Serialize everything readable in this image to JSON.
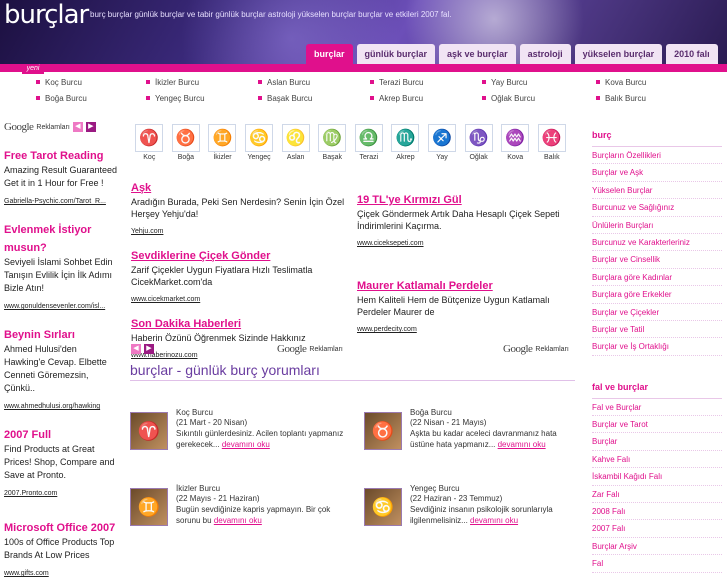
{
  "header": {
    "logo": "burçlar",
    "tagline": "burç burçlar günlük burçlar ve tabir günlük burçlar astroloji yükselen burçlar burçlar ve etkileri 2007 fal."
  },
  "tabs": [
    "burçlar",
    "günlük burçlar",
    "aşk ve burçlar",
    "astroloji",
    "yükselen burçlar",
    "2010 falı"
  ],
  "yeni": "yeni",
  "sign_nav": [
    "Koç Burcu",
    "İkizler Burcu",
    "Aslan Burcu",
    "Terazi Burcu",
    "Yay Burcu",
    "Kova Burcu",
    "Boğa Burcu",
    "Yengeç Burcu",
    "Başak Burcu",
    "Akrep Burcu",
    "Oğlak Burcu",
    "Balık Burcu"
  ],
  "google": {
    "logo": "Google",
    "label": "Reklamları"
  },
  "left_ads": [
    {
      "title": "Free Tarot Reading",
      "body": "Amazing Result Guaranteed Get it in 1 Hour for Free !",
      "url": "Gabriella-Psychic.com/Tarot_R..."
    },
    {
      "title": "Evlenmek İstiyor musun?",
      "body": "Seviyeli İslami Sohbet Edin Tanışın Evlilik İçin İlk Adımı Bizle Atın!",
      "url": "www.gonuldensevenler.com/isl..."
    },
    {
      "title": "Beynin Sırları",
      "body": "Ahmed Hulusi'den Hawking'e Cevap. Elbette Cenneti Göremezsin, Çünkü..",
      "url": "www.ahmedhulusi.org/hawking"
    },
    {
      "title": "2007 Full",
      "body": "Find Products at Great Prices! Shop, Compare and Save at Pronto.",
      "url": "2007.Pronto.com"
    },
    {
      "title": "Microsoft Office 2007",
      "body": "100s of Office Products Top Brands At Low Prices",
      "url": "www.gifts.com"
    }
  ],
  "zodiac": [
    {
      "name": "Koç",
      "glyph": "♈"
    },
    {
      "name": "Boğa",
      "glyph": "♉"
    },
    {
      "name": "İkizler",
      "glyph": "♊"
    },
    {
      "name": "Yengeç",
      "glyph": "♋"
    },
    {
      "name": "Aslan",
      "glyph": "♌"
    },
    {
      "name": "Başak",
      "glyph": "♍"
    },
    {
      "name": "Terazi",
      "glyph": "♎"
    },
    {
      "name": "Akrep",
      "glyph": "♏"
    },
    {
      "name": "Yay",
      "glyph": "♐"
    },
    {
      "name": "Oğlak",
      "glyph": "♑"
    },
    {
      "name": "Kova",
      "glyph": "♒"
    },
    {
      "name": "Balık",
      "glyph": "♓"
    }
  ],
  "mid_ads_left": [
    {
      "title": "Aşk",
      "body": "Aradığın Burada, Peki Sen Nerdesin? Senin İçin Özel Herşey Yehju'da!",
      "url": "Yehju.com"
    },
    {
      "title": "Sevdiklerine Çiçek Gönder",
      "body": "Zarif Çiçekler Uygun Fiyatlara Hızlı Teslimatla CicekMarket.com'da",
      "url": "www.cicekmarket.com"
    },
    {
      "title": "Son Dakika Haberleri",
      "body": "Haberin Özünü Öğrenmek Sizinde Hakkınız",
      "url": "www.haberinozu.com"
    }
  ],
  "mid_ads_right": [
    {
      "title": "19 TL'ye Kırmızı Gül",
      "body": "Çiçek Göndermek Artık Daha Hesaplı Çiçek Sepeti İndirimlerini Kaçırma.",
      "url": "www.ciceksepeti.com"
    },
    {
      "title": "Maurer Katlamalı Perdeler",
      "body": "Hem Kaliteli Hem de Bütçenize Uygun Katlamalı Perdeler Maurer de",
      "url": "www.perdecity.com"
    }
  ],
  "section_title": "burçlar - günlük burç yorumları",
  "horoscopes": [
    {
      "name": "Koç Burcu",
      "dates": "(21 Mart - 20 Nisan)",
      "text": "Sıkıntılı günlerdesiniz. Acilen toplantı yapmanız gerekecek... ",
      "more": "devamını oku",
      "glyph": "♈"
    },
    {
      "name": "Boğa Burcu",
      "dates": "(22 Nisan - 21 Mayıs)",
      "text": "Aşkta bu kadar aceleci davranmanız hata üstüne hata yapmanız... ",
      "more": "devamını oku",
      "glyph": "♉"
    },
    {
      "name": "İkizler Burcu",
      "dates": "(22 Mayıs - 21 Haziran)",
      "text": "Bugün sevdiğinize kapris yapmayın. Bir çok sorunu bu ",
      "more": "devamını oku",
      "glyph": "♊"
    },
    {
      "name": "Yengeç Burcu",
      "dates": "(22 Haziran - 23 Temmuz)",
      "text": "Sevdiğiniz insanın psikolojik sorunlarıyla ilgilenmelisiniz... ",
      "more": "devamını oku",
      "glyph": "♋"
    }
  ],
  "right_sections": [
    {
      "heading": "burç",
      "items": [
        "Burçların Özellikleri",
        "Burçlar ve Aşk",
        "Yükselen Burçlar",
        "Burcunuz ve Sağlığınız",
        "Ünlülerin Burçları",
        "Burcunuz ve Karakterleriniz",
        "Burçlar ve Cinsellik",
        "Burçlara göre Kadınlar",
        "Burçlara göre Erkekler",
        "Burçlar ve Çiçekler",
        "Burçlar ve Tatil",
        "Burçlar ve İş Ortaklığı"
      ]
    },
    {
      "heading": "fal ve burçlar",
      "items": [
        "Fal ve Burçlar",
        "Burçlar ve Tarot",
        "Burçlar",
        "Kahve Falı",
        "İskambil Kağıdı Falı",
        "Zar Falı",
        "2008 Falı",
        "2007 Falı",
        "Burçlar Arşiv",
        "Fal"
      ]
    }
  ]
}
